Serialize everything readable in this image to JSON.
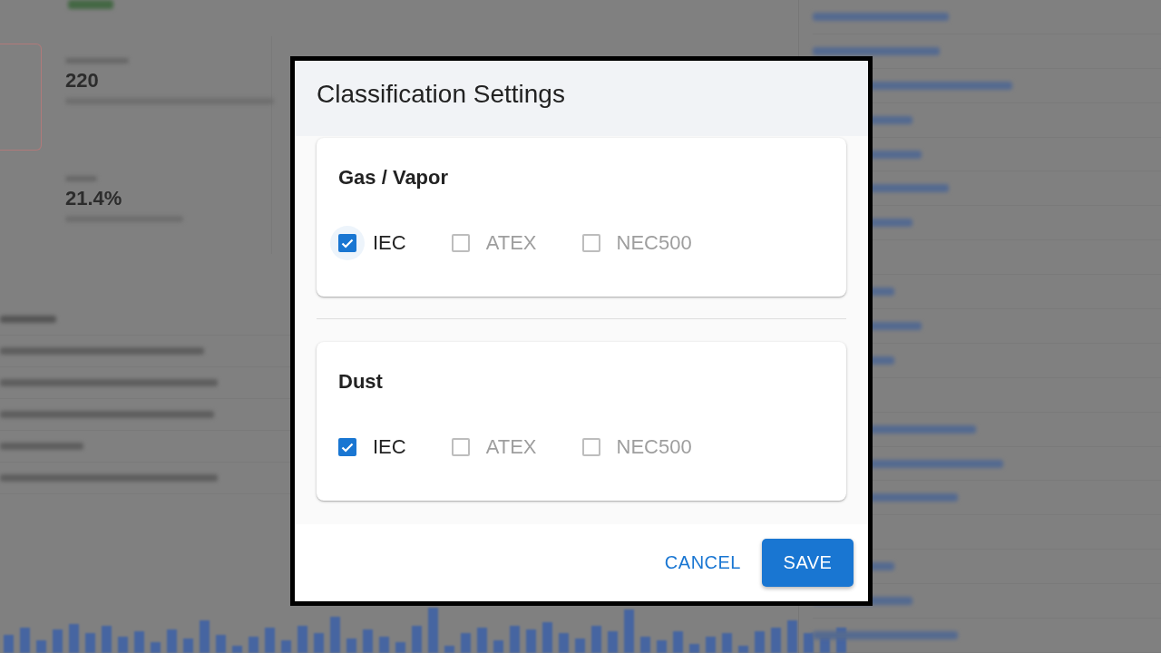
{
  "background": {
    "stats": [
      {
        "value": "220"
      },
      {
        "value": "21.4%"
      }
    ]
  },
  "dialog": {
    "title": "Classification Settings",
    "sections": [
      {
        "title": "Gas / Vapor",
        "options": [
          {
            "label": "IEC",
            "checked": true,
            "focused": true
          },
          {
            "label": "ATEX",
            "checked": false,
            "focused": false
          },
          {
            "label": "NEC500",
            "checked": false,
            "focused": false
          }
        ]
      },
      {
        "title": "Dust",
        "options": [
          {
            "label": "IEC",
            "checked": true,
            "focused": false
          },
          {
            "label": "ATEX",
            "checked": false,
            "focused": false
          },
          {
            "label": "NEC500",
            "checked": false,
            "focused": false
          }
        ]
      }
    ],
    "buttons": [
      {
        "label": "CANCEL",
        "kind": "text"
      },
      {
        "label": "SAVE",
        "kind": "contained"
      }
    ]
  }
}
